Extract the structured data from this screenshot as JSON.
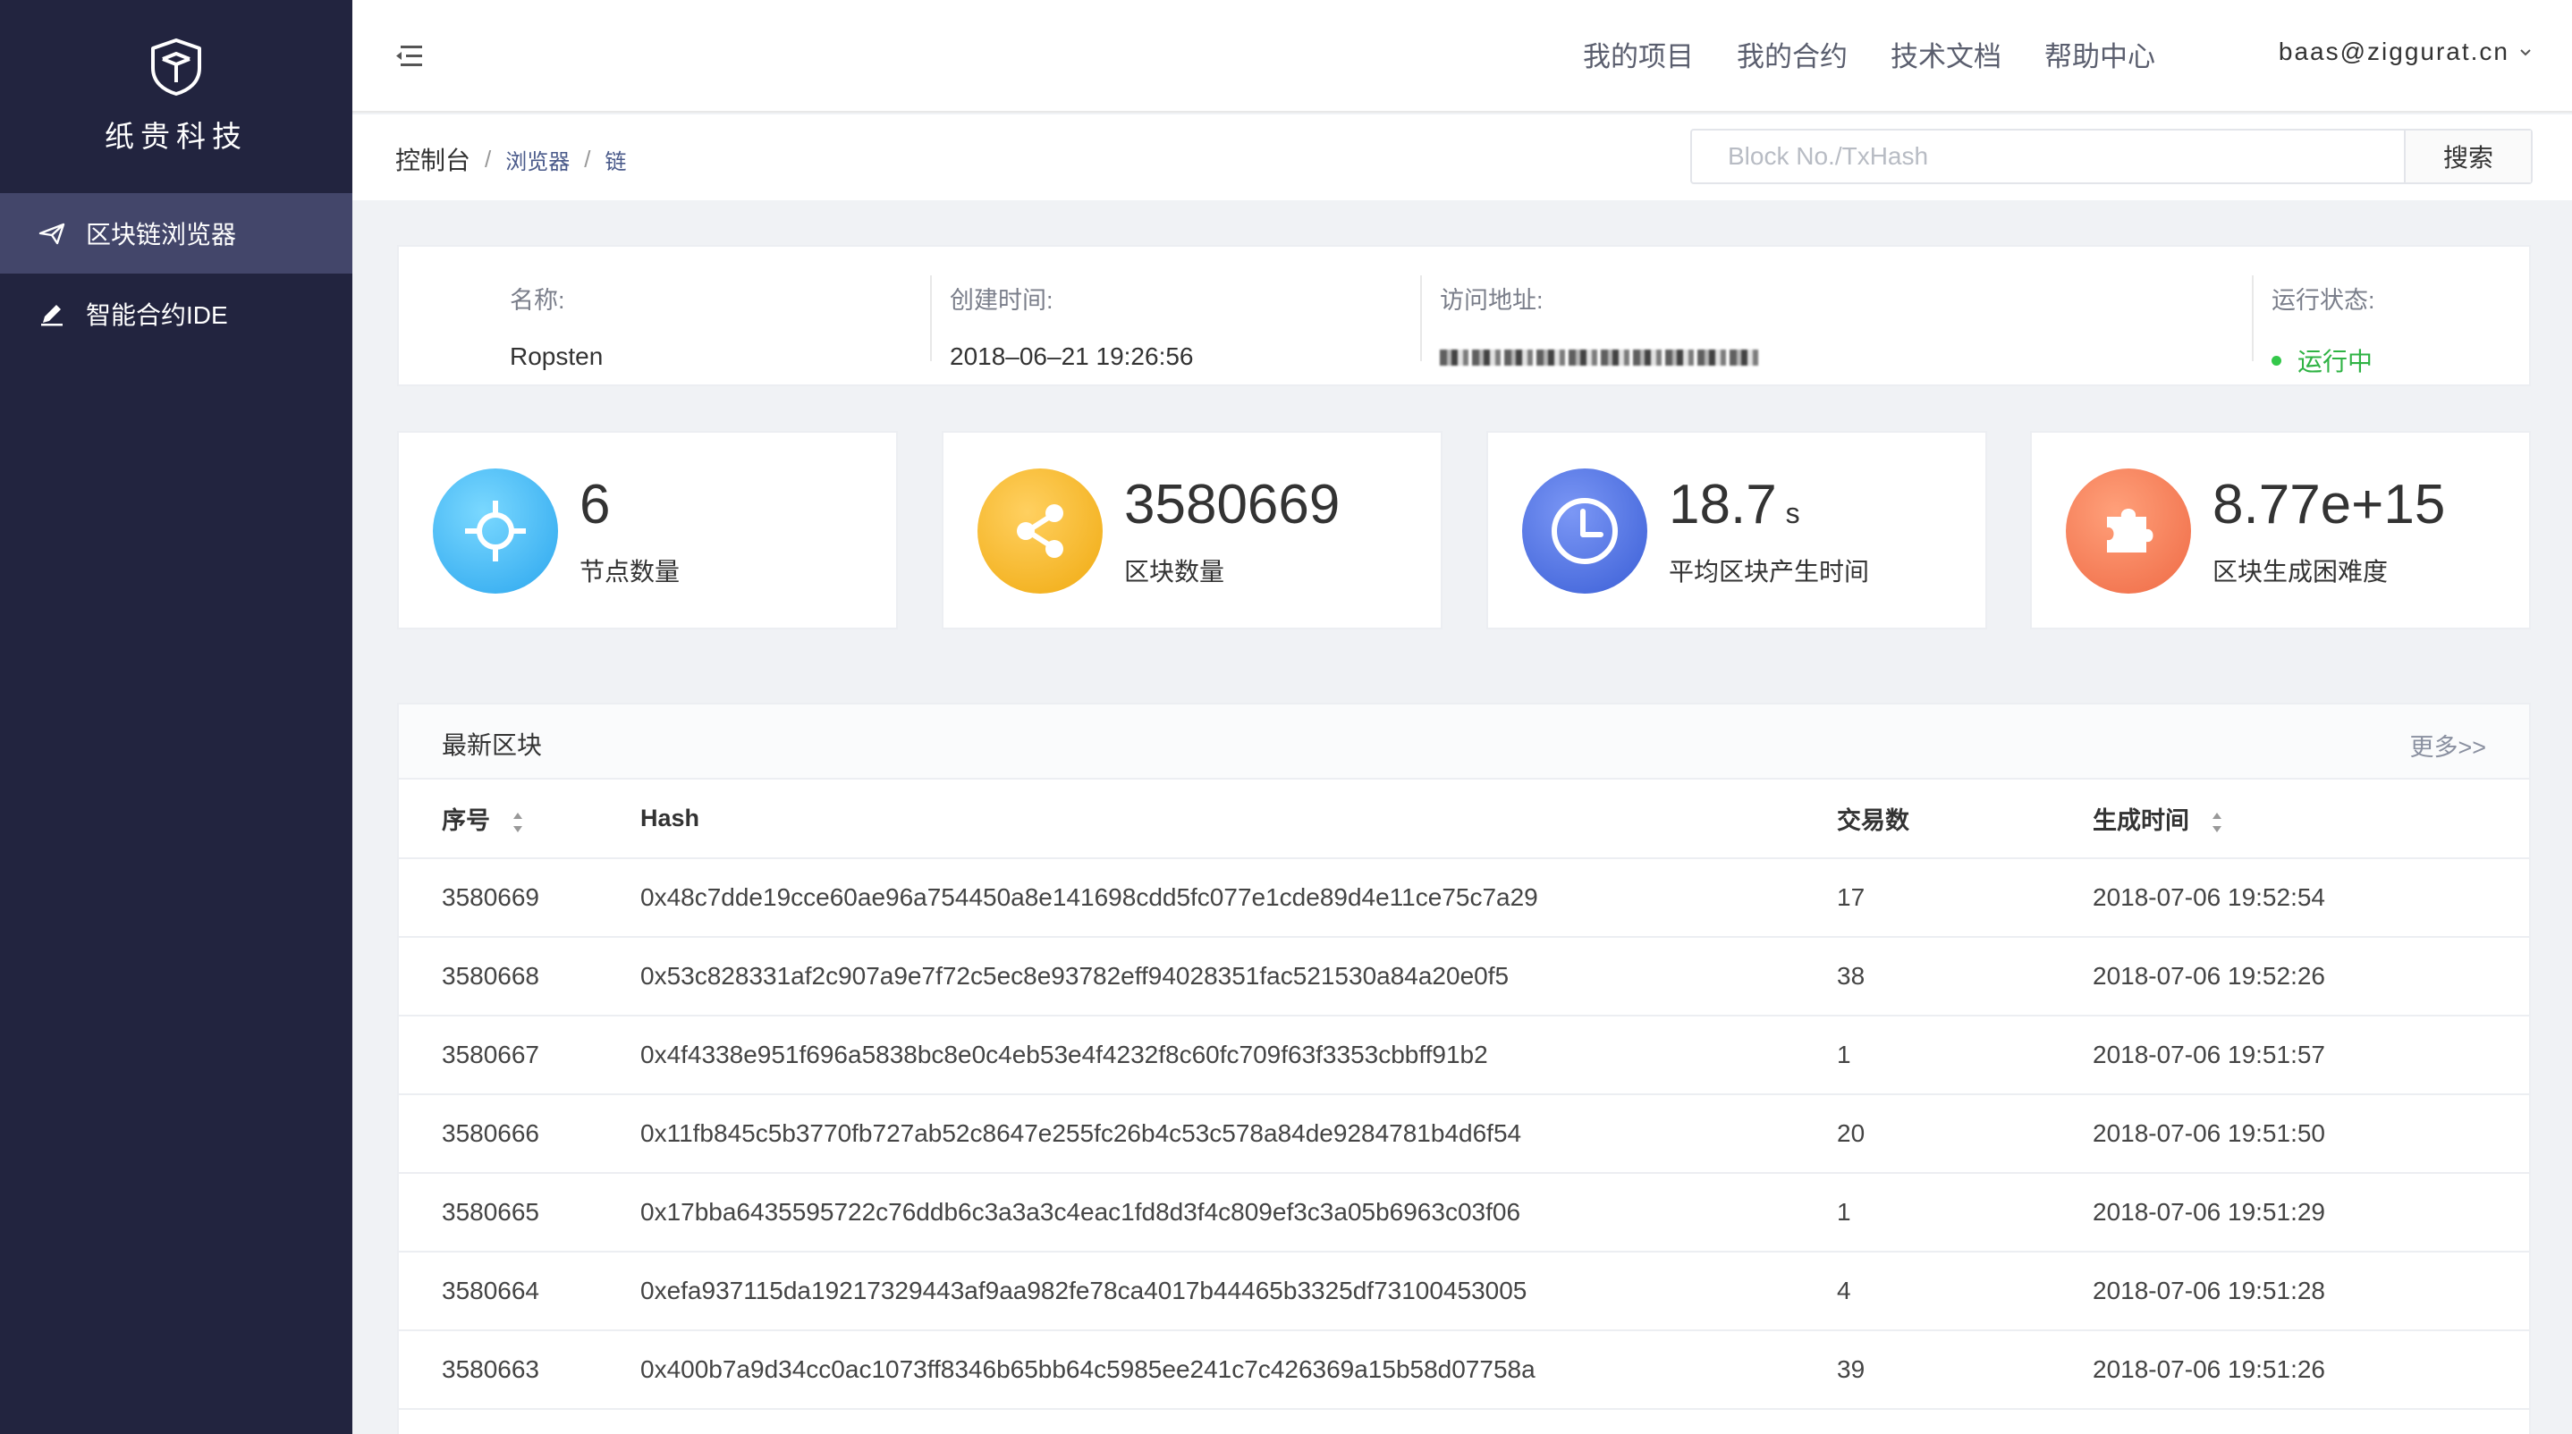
{
  "sidebar": {
    "logo_text": "纸贵科技",
    "items": [
      {
        "label": "区块链浏览器",
        "icon": "send-icon",
        "active": true
      },
      {
        "label": "智能合约IDE",
        "icon": "pen-icon",
        "active": false
      }
    ]
  },
  "topbar": {
    "links": [
      "我的项目",
      "我的合约",
      "技术文档",
      "帮助中心"
    ],
    "user": "baas@ziggurat.cn"
  },
  "breadcrumb": {
    "root": "控制台",
    "level2": "浏览器",
    "level3": "链",
    "sep": "/"
  },
  "search": {
    "placeholder": "Block No./TxHash",
    "value": "",
    "button_label": "搜索"
  },
  "info": {
    "name_label": "名称:",
    "name_value": "Ropsten",
    "created_label": "创建时间:",
    "created_value": "2018–06–21 19:26:56",
    "address_label": "访问地址:",
    "status_label": "运行状态:",
    "status_value": "运行中",
    "status_color": "#2fb344"
  },
  "stats": [
    {
      "value": "6",
      "unit": "",
      "label": "节点数量",
      "icon": "crosshair-icon",
      "color": "#3bb3f0"
    },
    {
      "value": "3580669",
      "unit": "",
      "label": "区块数量",
      "icon": "share-icon",
      "color": "#f5b621"
    },
    {
      "value": "18.7",
      "unit": "s",
      "label": "平均区块产生时间",
      "icon": "clock-icon",
      "color": "#4a6ee0"
    },
    {
      "value": "8.77e+15",
      "unit": "",
      "label": "区块生成困难度",
      "icon": "puzzle-icon",
      "color": "#f47a55"
    }
  ],
  "blocks": {
    "title": "最新区块",
    "more": "更多>>",
    "columns": [
      "序号",
      "Hash",
      "交易数",
      "生成时间"
    ],
    "rows": [
      {
        "no": "3580669",
        "hash": "0x48c7dde19cce60ae96a754450a8e141698cdd5fc077e1cde89d4e11ce75c7a29",
        "tx": "17",
        "time": "2018-07-06 19:52:54"
      },
      {
        "no": "3580668",
        "hash": "0x53c828331af2c907a9e7f72c5ec8e93782eff94028351fac521530a84a20e0f5",
        "tx": "38",
        "time": "2018-07-06 19:52:26"
      },
      {
        "no": "3580667",
        "hash": "0x4f4338e951f696a5838bc8e0c4eb53e4f4232f8c60fc709f63f3353cbbff91b2",
        "tx": "1",
        "time": "2018-07-06 19:51:57"
      },
      {
        "no": "3580666",
        "hash": "0x11fb845c5b3770fb727ab52c8647e255fc26b4c53c578a84de9284781b4d6f54",
        "tx": "20",
        "time": "2018-07-06 19:51:50"
      },
      {
        "no": "3580665",
        "hash": "0x17bba6435595722c76ddb6c3a3a3c4eac1fd8d3f4c809ef3c3a05b6963c03f06",
        "tx": "1",
        "time": "2018-07-06 19:51:29"
      },
      {
        "no": "3580664",
        "hash": "0xefa937115da19217329443af9aa982fe78ca4017b44465b3325df73100453005",
        "tx": "4",
        "time": "2018-07-06 19:51:28"
      },
      {
        "no": "3580663",
        "hash": "0x400b7a9d34cc0ac1073ff8346b65bb64c5985ee241c7c426369a15b58d07758a",
        "tx": "39",
        "time": "2018-07-06 19:51:26"
      }
    ]
  }
}
